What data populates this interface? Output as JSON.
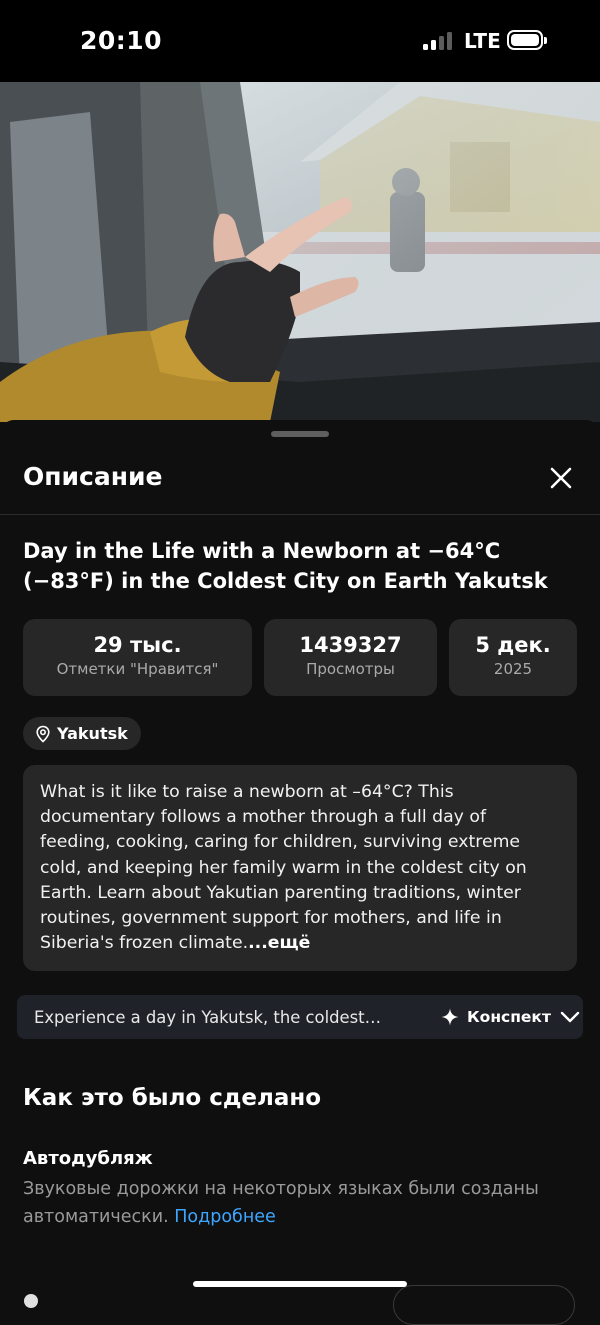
{
  "status_bar": {
    "time": "20:10",
    "network": "LTE",
    "signal_bars": 4,
    "signal_active": 2
  },
  "video": {
    "icon": "video-thumbnail",
    "progress_fraction": 0.7
  },
  "description_panel": {
    "title": "Описание",
    "close_icon": "close-icon"
  },
  "video_info": {
    "title": "Day in the Life with a Newborn at −64°C (−83°F) in the Coldest City on Earth Yakutsk",
    "stats": [
      {
        "value": "29 тыс.",
        "label": "Отметки \"Нравится\""
      },
      {
        "value": "1439327",
        "label": "Просмотры"
      },
      {
        "value": "5 дек.",
        "label": "2025"
      }
    ],
    "location": "Yakutsk",
    "description": "What is it like to raise a newborn at –64°C? This documentary follows a mother through a full day of feeding, cooking, caring for children, surviving extreme cold, and keeping her family warm in the coldest city on Earth. Learn about Yakutian parenting traditions, winter routines, government support for mothers, and life in Siberia's frozen climate.",
    "more_label": "...ещё"
  },
  "summary": {
    "text": "Experience a day in Yakutsk, the coldest…",
    "button_label": "Конспект"
  },
  "how_made": {
    "title": "Как это было сделано",
    "item_title": "Автодубляж",
    "item_text": "Звуковые дорожки на некоторых языках были созданы автоматически.",
    "item_link": "Подробнее"
  },
  "colors": {
    "background": "#0f0f0f",
    "card": "#272727",
    "link": "#3ea6ff",
    "secondary_text": "#aaaaaa"
  }
}
